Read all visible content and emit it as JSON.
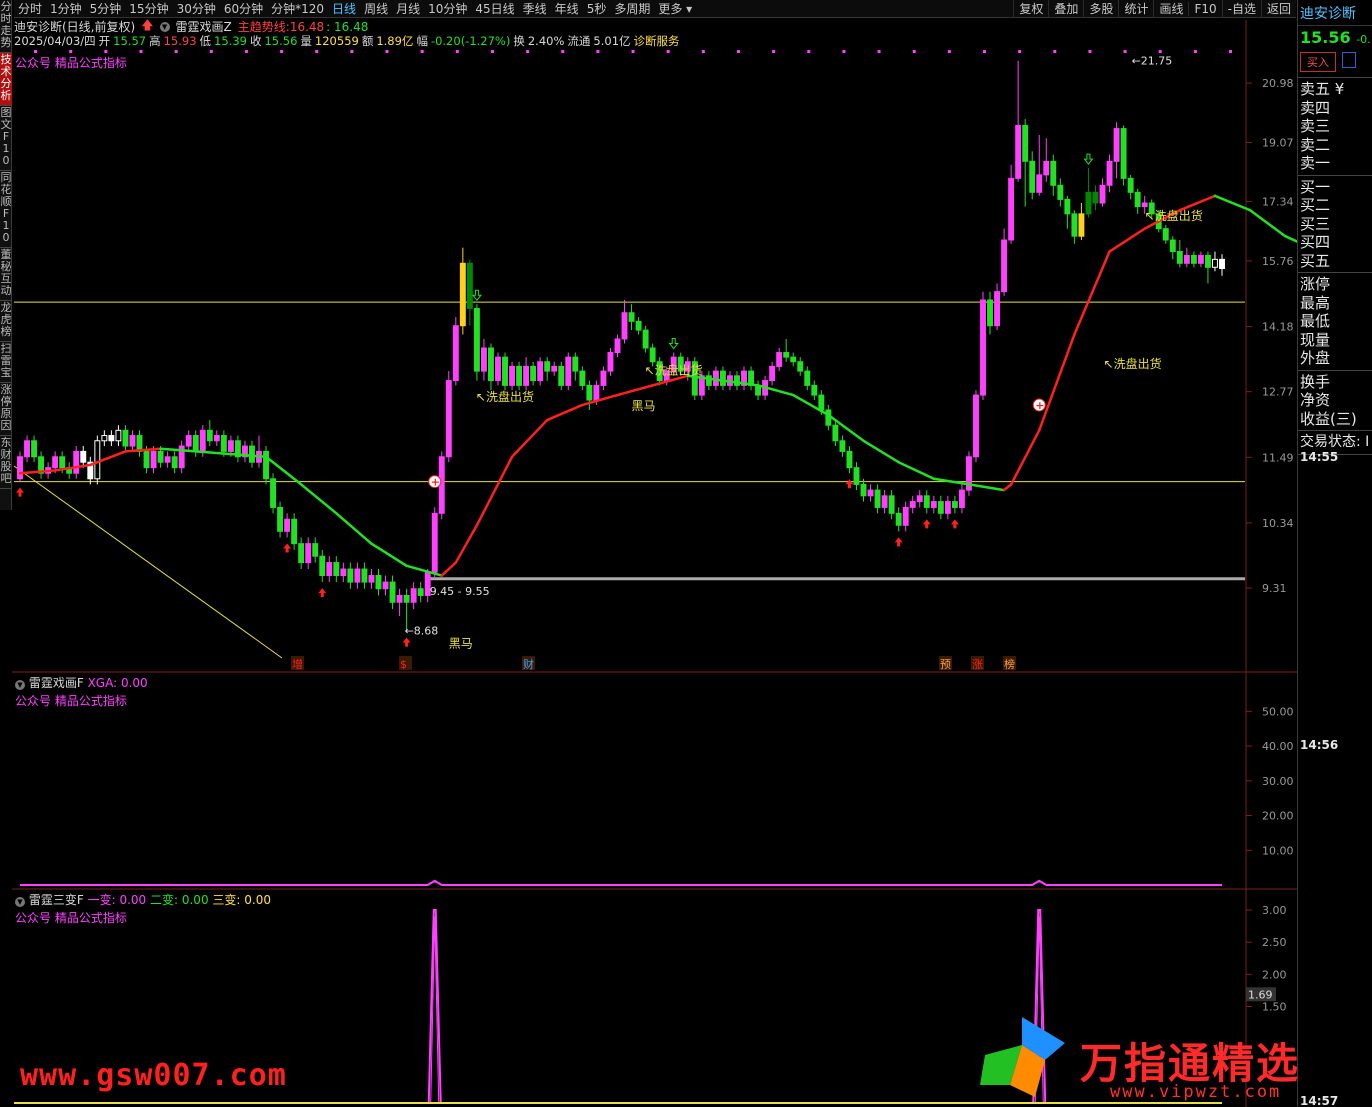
{
  "left_tabs": [
    "分时走势",
    "技术分析",
    "图文F10",
    "同花顺F10",
    "董秘互动",
    "龙虎榜",
    "扫雷宝",
    "涨停原因",
    "东财股吧"
  ],
  "toolbar": {
    "periods": [
      "分时",
      "1分钟",
      "5分钟",
      "15分钟",
      "30分钟",
      "60分钟",
      "分钟*120",
      "日线",
      "周线",
      "月线",
      "10分钟",
      "45日线",
      "季线",
      "年线",
      "5秒",
      "多周期",
      "更多"
    ],
    "active_period": "日线",
    "tools": [
      "复权",
      "叠加",
      "多股",
      "统计",
      "画线",
      "F10",
      "-自选",
      "返回"
    ]
  },
  "info1": {
    "stock": "迪安诊断(日线,前复权)",
    "indicator": "雷霆戏画Z",
    "main_trend_label": "主趋势线:",
    "main_trend_value": "16.48",
    "value2": ": 16.48"
  },
  "info2": {
    "date": "2025/04/03/四",
    "open_label": "开",
    "open": "15.57",
    "high_label": "高",
    "high": "15.93",
    "low_label": "低",
    "low": "15.39",
    "close_label": "收",
    "close": "15.56",
    "volume_label": "量",
    "volume": "120559",
    "amount_label": "额",
    "amount": "1.89亿",
    "change_label": "幅",
    "change": "-0.20(-1.27%)",
    "turnover_label": "换",
    "turnover": "2.40%",
    "float_label": "流通",
    "float": "5.01亿",
    "service": "诊断服务"
  },
  "panel_note": "公众号 精品公式指标",
  "main_axis_labels": [
    "20.98",
    "19.07",
    "17.34",
    "15.76",
    "14.18",
    "12.77",
    "11.49",
    "10.34",
    "9.31"
  ],
  "annotations": {
    "high_price": "21.75",
    "low_price": "8.68",
    "range": "9.45 - 9.55",
    "wash": "洗盘出货",
    "black_horse": "黑马"
  },
  "event_tags": [
    "增",
    "$",
    "财",
    "预",
    "涨",
    "榜"
  ],
  "sub1": {
    "name": "雷霆戏画F",
    "xga_label": "XGA:",
    "xga_value": "0.00",
    "axis": [
      "50.00",
      "40.00",
      "30.00",
      "20.00",
      "10.00"
    ]
  },
  "sub2": {
    "name": "雷霆三变F",
    "v1_label": "一变:",
    "v1": "0.00",
    "v2_label": "二变:",
    "v2": "0.00",
    "v3_label": "三变:",
    "v3": "0.00",
    "axis": [
      "3.00",
      "2.50",
      "2.00",
      "1.50"
    ],
    "cursor_value": "1.69"
  },
  "right_panel": {
    "title": "迪安诊断",
    "price": "15.56",
    "change_partial": "-0.",
    "buy_button": "买入",
    "sell_rows": [
      "卖五 ¥",
      "卖四",
      "卖三",
      "卖二",
      "卖一"
    ],
    "buy_rows": [
      "买一",
      "买二",
      "买三",
      "买四",
      "买五"
    ],
    "stats": [
      "涨停",
      "最高",
      "最低",
      "现量",
      "外盘"
    ],
    "stats2": [
      "换手",
      "净资",
      "收益(三)"
    ],
    "trade_status": "交易状态: I",
    "times": [
      "14:55",
      "14:56",
      "14:57"
    ]
  },
  "watermarks": {
    "left": "www.gsw007.com",
    "right": "万指通精选",
    "url": "www.vipwzt.com"
  },
  "colors": {
    "up": "#ff40ff",
    "down": "#22e022",
    "trend_up": "#ff2020",
    "trend_down": "#22e022",
    "support": "#e8e040",
    "indicator": "#ff40ff"
  },
  "chart_data": {
    "type": "candlestick",
    "ylim": [
      8.4,
      22.2
    ],
    "log_scale": true,
    "axis_ticks": [
      20.98,
      19.07,
      17.34,
      15.76,
      14.18,
      12.77,
      11.49,
      10.34,
      9.31
    ],
    "support_lines": [
      14.75,
      11.05
    ],
    "floor_line": 9.45,
    "candles": [
      [
        11.1,
        11.5,
        11.05,
        11.6
      ],
      [
        11.5,
        11.8,
        11.4,
        11.9
      ],
      [
        11.8,
        11.5,
        11.4,
        11.9
      ],
      [
        11.5,
        11.2,
        11.1,
        11.6
      ],
      [
        11.2,
        11.3,
        11.1,
        11.4
      ],
      [
        11.3,
        11.5,
        11.2,
        11.6
      ],
      [
        11.5,
        11.3,
        11.2,
        11.6
      ],
      [
        11.3,
        11.2,
        11.1,
        11.4
      ],
      [
        11.2,
        11.6,
        11.1,
        11.7
      ],
      [
        11.6,
        11.4,
        11.3,
        11.7
      ],
      [
        11.4,
        11.1,
        11.0,
        11.5
      ],
      [
        11.1,
        11.8,
        11.0,
        11.9
      ],
      [
        11.8,
        11.9,
        11.7,
        12.0
      ],
      [
        11.9,
        11.8,
        11.7,
        12.0
      ],
      [
        11.8,
        12.0,
        11.7,
        12.1
      ],
      [
        12.0,
        11.7,
        11.6,
        12.1
      ],
      [
        11.7,
        11.9,
        11.6,
        12.0
      ],
      [
        11.9,
        11.6,
        11.5,
        12.0
      ],
      [
        11.6,
        11.3,
        11.2,
        11.7
      ],
      [
        11.3,
        11.6,
        11.2,
        11.7
      ],
      [
        11.6,
        11.4,
        11.3,
        11.7
      ],
      [
        11.4,
        11.5,
        11.3,
        11.6
      ],
      [
        11.5,
        11.3,
        11.2,
        11.6
      ],
      [
        11.3,
        11.7,
        11.2,
        11.8
      ],
      [
        11.7,
        11.9,
        11.6,
        12.0
      ],
      [
        11.9,
        11.6,
        11.5,
        12.0
      ],
      [
        11.6,
        12.0,
        11.5,
        12.1
      ],
      [
        12.0,
        11.8,
        11.7,
        12.2
      ],
      [
        11.8,
        11.9,
        11.7,
        12.0
      ],
      [
        11.9,
        11.6,
        11.5,
        12.0
      ],
      [
        11.6,
        11.8,
        11.5,
        11.9
      ],
      [
        11.8,
        11.5,
        11.4,
        11.9
      ],
      [
        11.5,
        11.7,
        11.4,
        11.8
      ],
      [
        11.7,
        11.4,
        11.3,
        11.8
      ],
      [
        11.4,
        11.6,
        11.3,
        11.9
      ],
      [
        11.6,
        11.1,
        11.0,
        11.7
      ],
      [
        11.1,
        10.6,
        10.5,
        11.2
      ],
      [
        10.6,
        10.2,
        10.1,
        10.7
      ],
      [
        10.2,
        10.4,
        10.1,
        10.5
      ],
      [
        10.4,
        10.0,
        9.9,
        10.5
      ],
      [
        10.0,
        9.7,
        9.6,
        10.1
      ],
      [
        9.7,
        10.0,
        9.6,
        10.1
      ],
      [
        10.0,
        9.8,
        9.7,
        10.1
      ],
      [
        9.8,
        9.5,
        9.4,
        9.9
      ],
      [
        9.5,
        9.7,
        9.4,
        9.8
      ],
      [
        9.7,
        9.5,
        9.4,
        9.8
      ],
      [
        9.5,
        9.6,
        9.4,
        9.7
      ],
      [
        9.6,
        9.4,
        9.3,
        9.7
      ],
      [
        9.4,
        9.6,
        9.3,
        9.7
      ],
      [
        9.6,
        9.4,
        9.3,
        9.7
      ],
      [
        9.4,
        9.5,
        9.3,
        9.6
      ],
      [
        9.5,
        9.3,
        9.2,
        9.6
      ],
      [
        9.3,
        9.4,
        9.2,
        9.5
      ],
      [
        9.4,
        9.1,
        9.0,
        9.5
      ],
      [
        9.1,
        9.2,
        8.9,
        9.3
      ],
      [
        9.2,
        9.1,
        8.68,
        9.3
      ],
      [
        9.1,
        9.3,
        9.0,
        9.4
      ],
      [
        9.3,
        9.2,
        9.1,
        9.4
      ],
      [
        9.2,
        9.55,
        9.1,
        9.6
      ],
      [
        9.55,
        10.5,
        9.45,
        10.6
      ],
      [
        10.5,
        11.5,
        10.4,
        11.6
      ],
      [
        11.5,
        13.0,
        11.4,
        13.2
      ],
      [
        13.0,
        14.2,
        12.9,
        14.4
      ],
      [
        14.2,
        15.7,
        14.0,
        16.1
      ],
      [
        15.7,
        14.6,
        14.2,
        15.8
      ],
      [
        14.6,
        13.2,
        13.0,
        14.7
      ],
      [
        13.2,
        13.7,
        13.0,
        13.9
      ],
      [
        13.7,
        13.0,
        12.8,
        13.8
      ],
      [
        13.0,
        13.5,
        12.9,
        13.6
      ],
      [
        13.5,
        12.9,
        12.8,
        13.6
      ],
      [
        12.9,
        13.3,
        12.8,
        13.4
      ],
      [
        13.3,
        12.9,
        12.8,
        13.4
      ],
      [
        12.9,
        13.3,
        12.8,
        13.5
      ],
      [
        13.3,
        13.0,
        12.9,
        13.4
      ],
      [
        13.0,
        13.4,
        12.9,
        13.5
      ],
      [
        13.4,
        13.2,
        13.0,
        13.5
      ],
      [
        13.2,
        13.3,
        13.1,
        13.4
      ],
      [
        13.3,
        12.9,
        12.8,
        13.4
      ],
      [
        12.9,
        13.5,
        12.8,
        13.6
      ],
      [
        13.5,
        13.2,
        13.0,
        13.6
      ],
      [
        13.2,
        12.9,
        12.8,
        13.3
      ],
      [
        12.9,
        12.6,
        12.4,
        13.0
      ],
      [
        12.6,
        12.9,
        12.5,
        13.0
      ],
      [
        12.9,
        13.2,
        12.8,
        13.3
      ],
      [
        13.2,
        13.6,
        13.1,
        13.7
      ],
      [
        13.6,
        13.9,
        13.5,
        14.0
      ],
      [
        13.9,
        14.5,
        13.8,
        14.8
      ],
      [
        14.5,
        14.3,
        14.1,
        14.7
      ],
      [
        14.3,
        14.1,
        14.0,
        14.4
      ],
      [
        14.1,
        13.7,
        13.6,
        14.2
      ],
      [
        13.7,
        13.4,
        13.3,
        13.8
      ],
      [
        13.4,
        13.0,
        12.9,
        13.5
      ],
      [
        13.0,
        13.2,
        12.9,
        13.3
      ],
      [
        13.2,
        13.5,
        13.1,
        13.6
      ],
      [
        13.5,
        13.2,
        13.1,
        13.6
      ],
      [
        13.2,
        13.4,
        13.0,
        13.5
      ],
      [
        13.4,
        12.7,
        12.6,
        13.5
      ],
      [
        12.7,
        13.1,
        12.6,
        13.2
      ],
      [
        13.1,
        12.9,
        12.8,
        13.2
      ],
      [
        12.9,
        13.2,
        12.8,
        13.3
      ],
      [
        13.2,
        12.9,
        12.8,
        13.3
      ],
      [
        12.9,
        13.1,
        12.8,
        13.2
      ],
      [
        13.1,
        12.9,
        12.8,
        13.2
      ],
      [
        12.9,
        13.2,
        12.8,
        13.3
      ],
      [
        13.2,
        12.9,
        12.8,
        13.3
      ],
      [
        12.9,
        12.7,
        12.6,
        13.0
      ],
      [
        12.7,
        13.0,
        12.6,
        13.1
      ],
      [
        13.0,
        13.3,
        12.9,
        13.4
      ],
      [
        13.3,
        13.6,
        13.2,
        13.7
      ],
      [
        13.6,
        13.5,
        13.4,
        13.9
      ],
      [
        13.5,
        13.4,
        13.3,
        13.6
      ],
      [
        13.4,
        13.2,
        13.1,
        13.5
      ],
      [
        13.2,
        12.9,
        12.8,
        13.3
      ],
      [
        12.9,
        12.7,
        12.6,
        13.0
      ],
      [
        12.7,
        12.4,
        12.3,
        12.8
      ],
      [
        12.4,
        12.1,
        12.0,
        12.5
      ],
      [
        12.1,
        11.8,
        11.7,
        12.2
      ],
      [
        11.8,
        11.6,
        11.5,
        11.9
      ],
      [
        11.6,
        11.3,
        11.2,
        11.7
      ],
      [
        11.3,
        11.0,
        10.9,
        11.4
      ],
      [
        11.0,
        10.8,
        10.7,
        11.1
      ],
      [
        10.8,
        10.9,
        10.7,
        11.0
      ],
      [
        10.9,
        10.6,
        10.5,
        11.0
      ],
      [
        10.6,
        10.8,
        10.5,
        10.9
      ],
      [
        10.8,
        10.5,
        10.4,
        10.9
      ],
      [
        10.5,
        10.3,
        10.2,
        10.6
      ],
      [
        10.3,
        10.6,
        10.2,
        10.7
      ],
      [
        10.6,
        10.7,
        10.5,
        10.8
      ],
      [
        10.7,
        10.8,
        10.6,
        10.9
      ],
      [
        10.8,
        10.6,
        10.5,
        10.9
      ],
      [
        10.6,
        10.7,
        10.5,
        10.8
      ],
      [
        10.7,
        10.5,
        10.4,
        10.8
      ],
      [
        10.5,
        10.7,
        10.4,
        10.8
      ],
      [
        10.7,
        10.6,
        10.5,
        10.8
      ],
      [
        10.6,
        10.9,
        10.5,
        11.0
      ],
      [
        10.9,
        11.5,
        10.8,
        11.6
      ],
      [
        11.5,
        12.7,
        11.4,
        12.8
      ],
      [
        12.7,
        14.8,
        12.6,
        15.0
      ],
      [
        14.8,
        14.2,
        14.0,
        15.0
      ],
      [
        14.2,
        15.0,
        14.1,
        15.2
      ],
      [
        15.0,
        16.3,
        14.9,
        16.6
      ],
      [
        16.3,
        18.0,
        16.2,
        18.4
      ],
      [
        18.0,
        19.6,
        17.9,
        21.75
      ],
      [
        19.6,
        18.5,
        17.2,
        19.8
      ],
      [
        18.5,
        17.6,
        17.4,
        18.8
      ],
      [
        17.6,
        18.1,
        17.5,
        19.3
      ],
      [
        18.1,
        18.5,
        17.9,
        19.2
      ],
      [
        18.5,
        17.8,
        17.5,
        18.7
      ],
      [
        17.8,
        17.4,
        17.2,
        18.0
      ],
      [
        17.4,
        17.0,
        16.6,
        17.5
      ],
      [
        17.0,
        16.4,
        16.2,
        17.1
      ],
      [
        16.4,
        17.0,
        16.3,
        17.3
      ],
      [
        17.0,
        17.6,
        16.9,
        18.3
      ],
      [
        17.6,
        17.3,
        17.1,
        17.8
      ],
      [
        17.3,
        17.8,
        17.2,
        18.0
      ],
      [
        17.8,
        18.5,
        17.6,
        18.7
      ],
      [
        18.5,
        19.5,
        18.0,
        19.7
      ],
      [
        19.5,
        18.0,
        17.8,
        19.6
      ],
      [
        18.0,
        17.6,
        17.4,
        18.1
      ],
      [
        17.6,
        17.2,
        17.0,
        17.7
      ],
      [
        17.2,
        17.3,
        17.0,
        17.5
      ],
      [
        17.3,
        17.0,
        16.9,
        17.4
      ],
      [
        17.0,
        16.6,
        16.5,
        17.1
      ],
      [
        16.6,
        16.3,
        16.2,
        16.7
      ],
      [
        16.3,
        16.0,
        15.8,
        16.4
      ],
      [
        16.0,
        15.7,
        15.6,
        16.3
      ],
      [
        15.7,
        15.9,
        15.6,
        16.1
      ],
      [
        15.9,
        15.7,
        15.6,
        16.0
      ],
      [
        15.7,
        15.9,
        15.6,
        16.0
      ],
      [
        15.9,
        15.6,
        15.2,
        16.0
      ],
      [
        15.6,
        15.8,
        15.5,
        16.0
      ],
      [
        15.8,
        15.57,
        15.39,
        15.93
      ]
    ],
    "trend_points": [
      [
        0,
        11.2
      ],
      [
        5,
        11.25
      ],
      [
        10,
        11.35
      ],
      [
        15,
        11.6
      ],
      [
        20,
        11.65
      ],
      [
        25,
        11.6
      ],
      [
        30,
        11.55
      ],
      [
        35,
        11.5
      ],
      [
        40,
        11.0
      ],
      [
        45,
        10.5
      ],
      [
        50,
        10.0
      ],
      [
        55,
        9.65
      ],
      [
        60,
        9.5
      ],
      [
        62,
        9.7
      ],
      [
        65,
        10.3
      ],
      [
        70,
        11.5
      ],
      [
        75,
        12.2
      ],
      [
        80,
        12.5
      ],
      [
        85,
        12.7
      ],
      [
        90,
        12.9
      ],
      [
        95,
        13.1
      ],
      [
        100,
        13.0
      ],
      [
        105,
        12.9
      ],
      [
        110,
        12.7
      ],
      [
        115,
        12.3
      ],
      [
        120,
        11.8
      ],
      [
        125,
        11.4
      ],
      [
        130,
        11.1
      ],
      [
        135,
        11.0
      ],
      [
        140,
        10.9
      ],
      [
        141,
        11.0
      ],
      [
        145,
        12.0
      ],
      [
        150,
        14.0
      ],
      [
        155,
        16.0
      ],
      [
        160,
        16.6
      ],
      [
        165,
        17.1
      ],
      [
        170,
        17.5
      ],
      [
        175,
        17.1
      ],
      [
        180,
        16.4
      ],
      [
        186,
        15.9
      ]
    ]
  }
}
